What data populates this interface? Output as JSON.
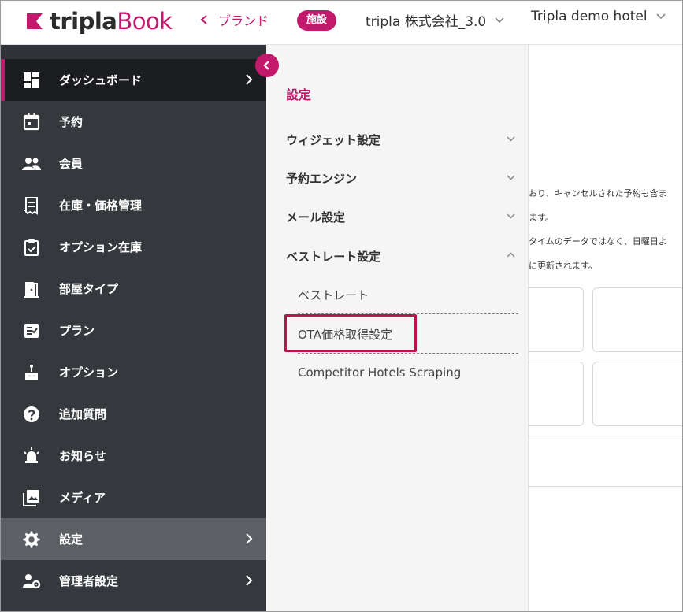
{
  "header": {
    "logo_part1": "tripla",
    "logo_part2": "Book",
    "back_label": "ブランド",
    "facility_badge": "施設",
    "company_name": "tripla 株式会社_3.0",
    "hotel_name": "Tripla demo hotel"
  },
  "sidebar": {
    "items": [
      {
        "label": "ダッシュボード",
        "icon": "dashboard-icon"
      },
      {
        "label": "予約",
        "icon": "calendar-icon"
      },
      {
        "label": "会員",
        "icon": "members-icon"
      },
      {
        "label": "在庫・価格管理",
        "icon": "inventory-icon"
      },
      {
        "label": "オプション在庫",
        "icon": "clipboard-check-icon"
      },
      {
        "label": "部屋タイプ",
        "icon": "door-icon"
      },
      {
        "label": "プラン",
        "icon": "plan-icon"
      },
      {
        "label": "オプション",
        "icon": "cake-icon"
      },
      {
        "label": "追加質問",
        "icon": "question-icon"
      },
      {
        "label": "お知らせ",
        "icon": "alarm-icon"
      },
      {
        "label": "メディア",
        "icon": "media-icon"
      },
      {
        "label": "設定",
        "icon": "gear-icon"
      },
      {
        "label": "管理者設定",
        "icon": "admin-icon"
      }
    ]
  },
  "settings_panel": {
    "title": "設定",
    "sections": [
      {
        "label": "ウィジェット設定",
        "expanded": false
      },
      {
        "label": "予約エンジン",
        "expanded": false
      },
      {
        "label": "メール設定",
        "expanded": false
      },
      {
        "label": "ベストレート設定",
        "expanded": true
      }
    ],
    "sub_items": [
      "ベストレート",
      "OTA価格取得設定",
      "Competitor Hotels Scraping"
    ]
  },
  "background": {
    "line1": "おり、キャンセルされた予約も含ま",
    "line2": "ます。",
    "line3": "タイムのデータではなく、日曜日よ",
    "line4": "に更新されます。"
  },
  "colors": {
    "brand": "#c3196c",
    "sidebar_bg": "#35383c",
    "highlight": "#b8154f"
  }
}
